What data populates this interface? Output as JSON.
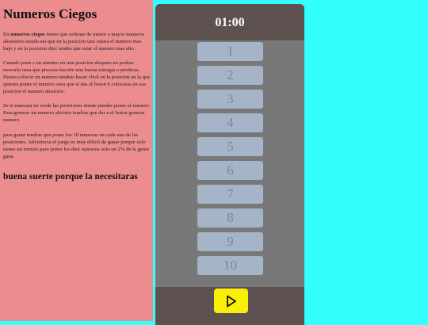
{
  "left": {
    "title": "Numeros Ciegos",
    "p1_prefix": "En ",
    "p1_bold": "numeros ciegos",
    "p1_rest": " tienes que ordenar de menor a mayor numeros aleatorios siendo asi que en la posicion uno estara el numero mas bajo y en la posicion diez tendra que estar el numero mas alto .",
    "p2": "Cuando pone s un nuemro en una posicion despues no podras moverla osea que procura hacerte una buena estragia o perderas. Parara colocar un numero tendras hacer click en la posicion en la que quieres poner el numero osea que si das al boton 6 colocaras en esa posicion el numero aleatorio.",
    "p3": "Se te marcara en verde las posiciones donde puedes poner el numero. Para generar un numero aletorio tendras que dar a el boton generar numero",
    "p4": "para ganar tendras que poner los 10 numeros en cada una de las posiciones. Advertecia el juego es muy dificil de ganar porque solo tienes un minuto para poner los diez numeros solo un 2% de la gente gana.",
    "luck": "buena suerte porque la necesitaras"
  },
  "game": {
    "timer": "01:00",
    "slots": [
      "1",
      "2",
      "3",
      "4",
      "5",
      "6",
      "7",
      "8",
      "9",
      "10"
    ],
    "play_icon": "play-icon"
  },
  "colors": {
    "background": "#33ffff",
    "left_panel": "#eb8c8e",
    "game_bar": "#5d5250",
    "slot": "#a5b4c6",
    "play_button": "#f8ee08"
  }
}
